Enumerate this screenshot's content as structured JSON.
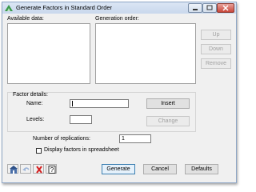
{
  "window": {
    "title": "Generate Factors in Standard Order",
    "controls": [
      "minimize-icon",
      "maximize-icon",
      "close-icon"
    ]
  },
  "lists": {
    "available_label": "Available data:",
    "generation_label": "Generation order:"
  },
  "side_buttons": {
    "up": "Up",
    "down": "Down",
    "remove": "Remove"
  },
  "factor_details": {
    "group_label": "Factor details:",
    "name_label": "Name:",
    "name_value": "",
    "levels_label": "Levels:",
    "levels_value": "",
    "insert": "Insert",
    "change": "Change"
  },
  "replications": {
    "label": "Number of replications:",
    "value": "1"
  },
  "spreadsheet": {
    "label": "Display factors in spreadsheet",
    "checked": false
  },
  "icons": [
    "pin-icon",
    "undo-icon",
    "clear-icon",
    "help-icon"
  ],
  "footer": {
    "generate": "Generate",
    "cancel": "Cancel",
    "defaults": "Defaults"
  },
  "colors": {
    "title_bar": "#c9d8ec",
    "close_button": "#c9463a",
    "default_border": "#3c7fb1"
  }
}
